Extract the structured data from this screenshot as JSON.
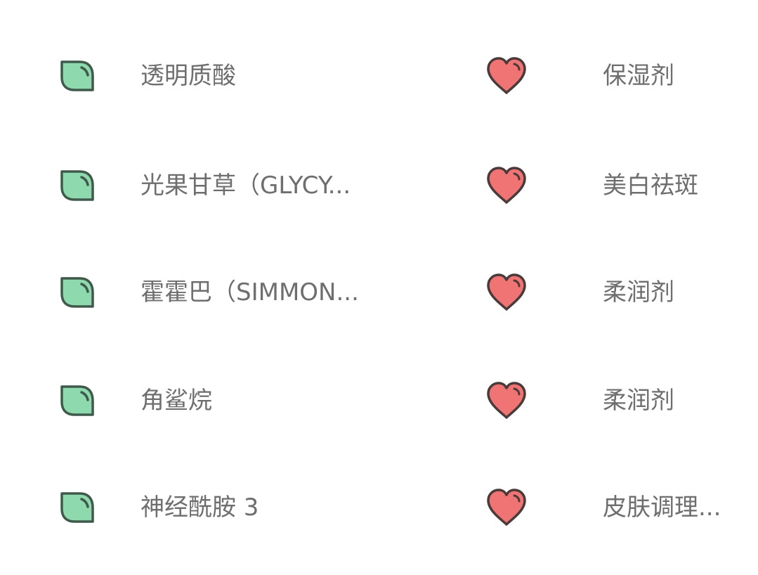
{
  "ingredients": [
    {
      "name": "透明质酸",
      "function": "保湿剂",
      "leaf_icon": "leaf-icon",
      "heart_icon": "heart-icon"
    },
    {
      "name": "光果甘草（GLYCY...",
      "function": "美白祛斑",
      "leaf_icon": "leaf-icon",
      "heart_icon": "heart-icon"
    },
    {
      "name": "霍霍巴（SIMMON...",
      "function": "柔润剂",
      "leaf_icon": "leaf-icon",
      "heart_icon": "heart-icon"
    },
    {
      "name": "角鲨烷",
      "function": "柔润剂",
      "leaf_icon": "leaf-icon",
      "heart_icon": "heart-icon"
    },
    {
      "name": "神经酰胺 3",
      "function": "皮肤调理...",
      "leaf_icon": "leaf-icon",
      "heart_icon": "heart-icon"
    }
  ],
  "colors": {
    "leaf_fill": "#8fd9ae",
    "leaf_stroke": "#3f5a4b",
    "heart_fill": "#f07474",
    "heart_stroke": "#4a3a3a",
    "text": "#6e6e6e"
  }
}
